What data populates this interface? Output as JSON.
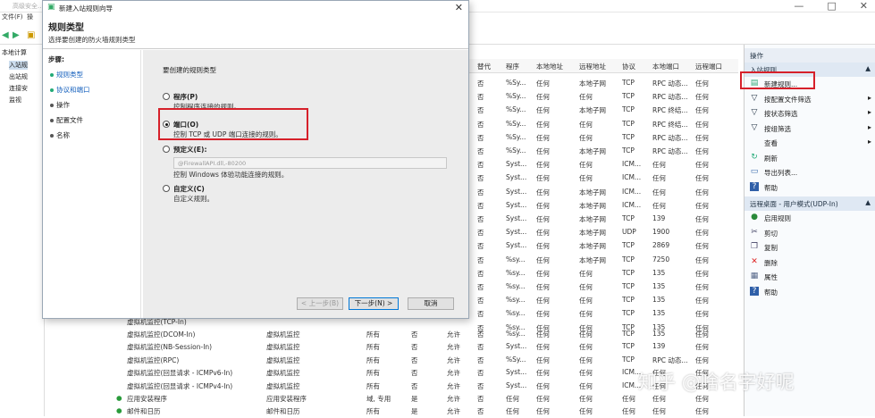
{
  "main_window": {
    "title": "高级安全...",
    "controls": [
      "—",
      "□",
      "✕"
    ],
    "menu": [
      "文件(F)",
      "操"
    ]
  },
  "tree": {
    "items": [
      "本地计算",
      "入站规",
      "出站规",
      "连接安",
      "监视"
    ]
  },
  "grid": {
    "columns": [
      "替代",
      "程序",
      "本地地址",
      "远程地址",
      "协议",
      "本地端口",
      "远程端口"
    ],
    "rows": [
      [
        "否",
        "%Sy...",
        "任何",
        "本地子网",
        "TCP",
        "RPC 动态...",
        "任何"
      ],
      [
        "否",
        "%Sy...",
        "任何",
        "任何",
        "TCP",
        "RPC 动态...",
        "任何"
      ],
      [
        "否",
        "%Sy...",
        "任何",
        "本地子网",
        "TCP",
        "RPC 终结...",
        "任何"
      ],
      [
        "否",
        "%Sy...",
        "任何",
        "任何",
        "TCP",
        "RPC 终结...",
        "任何"
      ],
      [
        "否",
        "%Sy...",
        "任何",
        "任何",
        "TCP",
        "RPC 动态...",
        "任何"
      ],
      [
        "否",
        "%Sy...",
        "任何",
        "本地子网",
        "TCP",
        "RPC 动态...",
        "任何"
      ],
      [
        "否",
        "Syst...",
        "任何",
        "任何",
        "ICM...",
        "任何",
        "任何"
      ],
      [
        "否",
        "Syst...",
        "任何",
        "任何",
        "ICM...",
        "任何",
        "任何"
      ],
      [
        "否",
        "Syst...",
        "任何",
        "本地子网",
        "ICM...",
        "任何",
        "任何"
      ],
      [
        "否",
        "Syst...",
        "任何",
        "本地子网",
        "ICM...",
        "任何",
        "任何"
      ],
      [
        "否",
        "Syst...",
        "任何",
        "本地子网",
        "TCP",
        "139",
        "任何"
      ],
      [
        "否",
        "Syst...",
        "任何",
        "本地子网",
        "UDP",
        "1900",
        "任何"
      ],
      [
        "否",
        "Syst...",
        "任何",
        "本地子网",
        "TCP",
        "2869",
        "任何"
      ],
      [
        "否",
        "%sy...",
        "任何",
        "本地子网",
        "TCP",
        "7250",
        "任何"
      ],
      [
        "否",
        "%sy...",
        "任何",
        "任何",
        "TCP",
        "135",
        "任何"
      ],
      [
        "否",
        "%sy...",
        "任何",
        "任何",
        "TCP",
        "135",
        "任何"
      ],
      [
        "否",
        "%sy...",
        "任何",
        "任何",
        "TCP",
        "135",
        "任何"
      ],
      [
        "否",
        "%sy...",
        "任何",
        "任何",
        "TCP",
        "135",
        "任何"
      ],
      [
        "否",
        "%sy...",
        "任何",
        "任何",
        "TCP",
        "135",
        "任何"
      ]
    ],
    "bottom_rows": [
      {
        "name": "虚拟机监控(DCOM-In)",
        "group": "虚拟机监控",
        "profile": "所有",
        "enabled": "否",
        "action": "允许",
        "override": "否",
        "program": "%sy...",
        "local": "任何",
        "remote": "任何",
        "protocol": "TCP",
        "lport": "135",
        "rport": "任何"
      },
      {
        "name": "虚拟机监控(NB-Session-In)",
        "group": "虚拟机监控",
        "profile": "所有",
        "enabled": "否",
        "action": "允许",
        "override": "否",
        "program": "Syst...",
        "local": "任何",
        "remote": "任何",
        "protocol": "TCP",
        "lport": "139",
        "rport": "任何"
      },
      {
        "name": "虚拟机监控(RPC)",
        "group": "虚拟机监控",
        "profile": "所有",
        "enabled": "否",
        "action": "允许",
        "override": "否",
        "program": "%Sy...",
        "local": "任何",
        "remote": "任何",
        "protocol": "TCP",
        "lport": "RPC 动态...",
        "rport": "任何"
      },
      {
        "name": "虚拟机监控(回显请求 - ICMPv6-In)",
        "group": "虚拟机监控",
        "profile": "所有",
        "enabled": "否",
        "action": "允许",
        "override": "否",
        "program": "Syst...",
        "local": "任何",
        "remote": "任何",
        "protocol": "ICM...",
        "lport": "任何",
        "rport": "任何"
      },
      {
        "name": "虚拟机监控(回显请求 - ICMPv4-In)",
        "group": "虚拟机监控",
        "profile": "所有",
        "enabled": "否",
        "action": "允许",
        "override": "否",
        "program": "Syst...",
        "local": "任何",
        "remote": "任何",
        "protocol": "ICM...",
        "lport": "任何",
        "rport": "任何"
      },
      {
        "name": "应用安装程序",
        "group": "应用安装程序",
        "profile": "域, 专用",
        "enabled": "是",
        "action": "允许",
        "override": "否",
        "program": "任何",
        "local": "任何",
        "remote": "任何",
        "protocol": "任何",
        "lport": "任何",
        "rport": "任何"
      },
      {
        "name": "邮件和日历",
        "group": "邮件和日历",
        "profile": "所有",
        "enabled": "是",
        "action": "允许",
        "override": "否",
        "program": "任何",
        "local": "任何",
        "remote": "任何",
        "protocol": "任何",
        "lport": "任何",
        "rport": "任何"
      }
    ],
    "partial_row": "虚拟机监控(TCP-In)"
  },
  "actions": {
    "header": "操作",
    "section1": "入站规则",
    "section1_items": [
      {
        "label": "新建规则...",
        "icon": "new-rule-icon",
        "arrow": ""
      },
      {
        "label": "按配置文件筛选",
        "icon": "filter-icon",
        "arrow": "▸"
      },
      {
        "label": "按状态筛选",
        "icon": "filter-icon",
        "arrow": "▸"
      },
      {
        "label": "按组筛选",
        "icon": "filter-icon",
        "arrow": "▸"
      },
      {
        "label": "查看",
        "icon": "",
        "arrow": "▸"
      },
      {
        "label": "刷新",
        "icon": "refresh-icon",
        "arrow": ""
      },
      {
        "label": "导出列表...",
        "icon": "export-icon",
        "arrow": ""
      },
      {
        "label": "帮助",
        "icon": "help-icon",
        "arrow": ""
      }
    ],
    "section2": "远程桌面 - 用户模式(UDP-In)",
    "section2_items": [
      {
        "label": "启用规则",
        "icon": "enable-icon"
      },
      {
        "label": "剪切",
        "icon": "cut-icon"
      },
      {
        "label": "复制",
        "icon": "copy-icon"
      },
      {
        "label": "删除",
        "icon": "delete-icon"
      },
      {
        "label": "属性",
        "icon": "properties-icon"
      },
      {
        "label": "帮助",
        "icon": "help-icon"
      }
    ]
  },
  "dialog": {
    "title": "新建入站规则向导",
    "heading": "规则类型",
    "subheading": "选择要创建的防火墙规则类型",
    "steps_title": "步骤:",
    "steps": [
      "规则类型",
      "协议和端口",
      "操作",
      "配置文件",
      "名称"
    ],
    "question": "要创建的规则类型",
    "options": [
      {
        "label": "程序(P)",
        "desc": "控制程序连接的规则。",
        "selected": false
      },
      {
        "label": "端口(O)",
        "desc": "控制 TCP 或 UDP 端口连接的规则。",
        "selected": true
      },
      {
        "label": "预定义(E):",
        "desc": "控制 Windows 体验功能连接的规则。",
        "selected": false
      },
      {
        "label": "自定义(C)",
        "desc": "自定义规则。",
        "selected": false
      }
    ],
    "predefined_value": "@FirewallAPI.dll,-80200",
    "buttons": {
      "back": "< 上一步(B)",
      "next": "下一步(N) >",
      "cancel": "取消"
    }
  },
  "watermark": "知乎 @啥名字好呢",
  "colors": {
    "highlight": "#d6202a",
    "accent": "#0078d7"
  }
}
